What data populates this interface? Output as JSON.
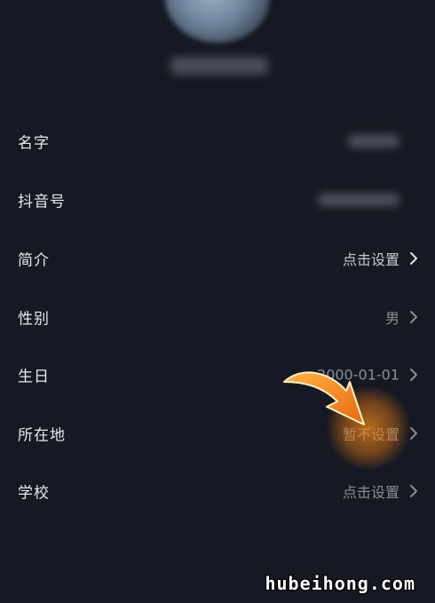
{
  "profile": {
    "fields": [
      {
        "label": "名字",
        "value": ""
      },
      {
        "label": "抖音号",
        "value": ""
      },
      {
        "label": "简介",
        "value": "点击设置"
      },
      {
        "label": "性别",
        "value": "男"
      },
      {
        "label": "生日",
        "value": "2000-01-01"
      },
      {
        "label": "所在地",
        "value": "暂不设置"
      },
      {
        "label": "学校",
        "value": "点击设置"
      }
    ]
  },
  "watermark": "hubeihong.com",
  "colors": {
    "background": "#161823",
    "label_text": "#e8e8ea",
    "value_text": "#8c8d94",
    "highlight_arrow": "#f28a1c"
  },
  "icons": {
    "row_chevron": "chevron-right-icon",
    "annotation": "orange-arrow-icon"
  }
}
